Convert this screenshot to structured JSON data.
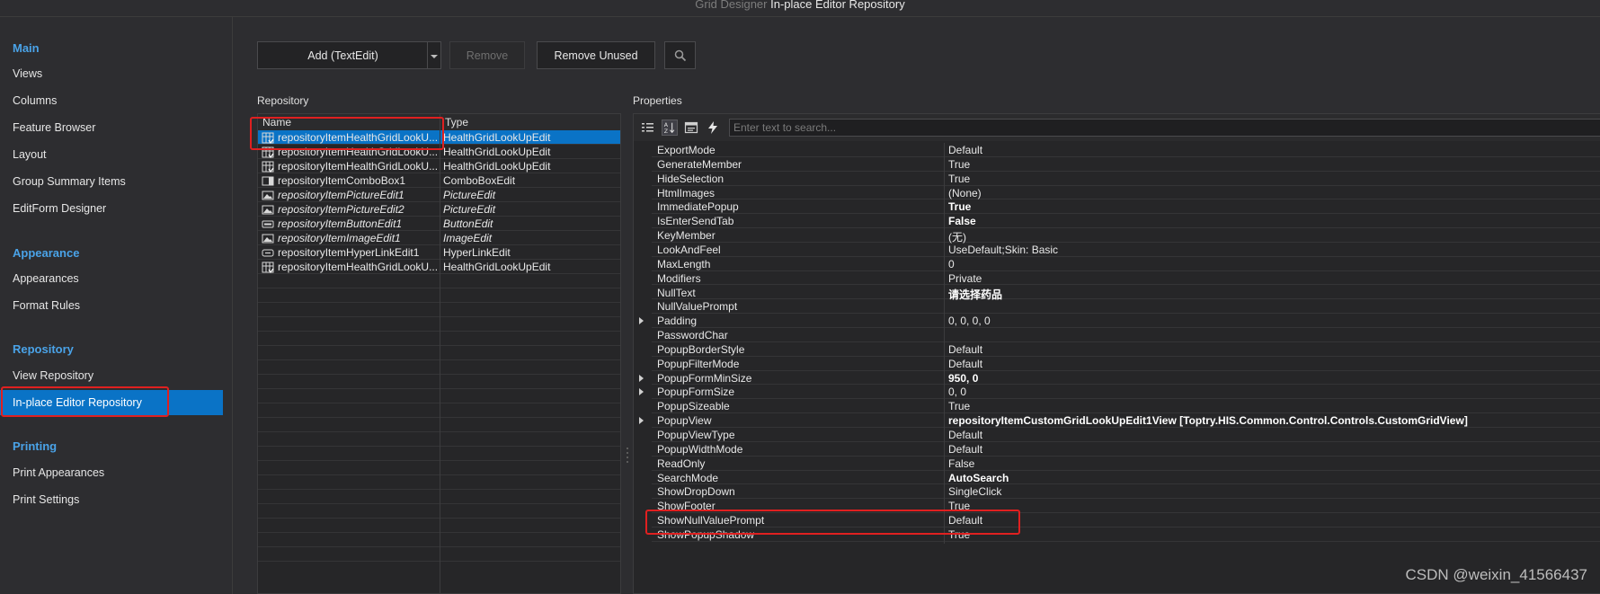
{
  "window": {
    "title_prefix": "Grid Designer",
    "title_main": "In-place Editor Repository"
  },
  "sidebar": {
    "groups": [
      {
        "label": "Main",
        "items": [
          "Views",
          "Columns",
          "Feature Browser",
          "Layout",
          "Group Summary Items",
          "EditForm Designer"
        ]
      },
      {
        "label": "Appearance",
        "items": [
          "Appearances",
          "Format Rules"
        ]
      },
      {
        "label": "Repository",
        "items": [
          "View Repository",
          "In-place Editor Repository"
        ]
      },
      {
        "label": "Printing",
        "items": [
          "Print Appearances",
          "Print Settings"
        ]
      }
    ],
    "selected": "In-place Editor Repository"
  },
  "toolbar": {
    "add_label": "Add (TextEdit)",
    "remove_label": "Remove",
    "remove_unused_label": "Remove Unused"
  },
  "repository": {
    "label": "Repository",
    "col_name": "Name",
    "col_type": "Type",
    "rows": [
      {
        "name": "repositoryItemHealthGridLookU...",
        "type": "HealthGridLookUpEdit",
        "icon": "grid-lookup-icon",
        "italic": false,
        "selected": true
      },
      {
        "name": "repositoryItemHealthGridLookU...",
        "type": "HealthGridLookUpEdit",
        "icon": "grid-lookup-icon",
        "italic": false,
        "selected": false
      },
      {
        "name": "repositoryItemHealthGridLookU...",
        "type": "HealthGridLookUpEdit",
        "icon": "grid-lookup-icon",
        "italic": false,
        "selected": false
      },
      {
        "name": "repositoryItemComboBox1",
        "type": "ComboBoxEdit",
        "icon": "combobox-icon",
        "italic": false,
        "selected": false
      },
      {
        "name": "repositoryItemPictureEdit1",
        "type": "PictureEdit",
        "icon": "picture-icon",
        "italic": true,
        "selected": false
      },
      {
        "name": "repositoryItemPictureEdit2",
        "type": "PictureEdit",
        "icon": "picture-icon",
        "italic": true,
        "selected": false
      },
      {
        "name": "repositoryItemButtonEdit1",
        "type": "ButtonEdit",
        "icon": "button-edit-icon",
        "italic": true,
        "selected": false
      },
      {
        "name": "repositoryItemImageEdit1",
        "type": "ImageEdit",
        "icon": "picture-icon",
        "italic": true,
        "selected": false
      },
      {
        "name": "repositoryItemHyperLinkEdit1",
        "type": "HyperLinkEdit",
        "icon": "hyperlink-icon",
        "italic": false,
        "selected": false
      },
      {
        "name": "repositoryItemHealthGridLookU...",
        "type": "HealthGridLookUpEdit",
        "icon": "grid-lookup-icon",
        "italic": false,
        "selected": false
      }
    ]
  },
  "properties": {
    "label": "Properties",
    "search_placeholder": "Enter text to search...",
    "rows": [
      {
        "name": "ExportMode",
        "value": "Default",
        "bold": false,
        "expandable": false
      },
      {
        "name": "GenerateMember",
        "value": "True",
        "bold": false,
        "expandable": false
      },
      {
        "name": "HideSelection",
        "value": "True",
        "bold": false,
        "expandable": false
      },
      {
        "name": "HtmlImages",
        "value": "(None)",
        "bold": false,
        "expandable": false
      },
      {
        "name": "ImmediatePopup",
        "value": "True",
        "bold": true,
        "expandable": false
      },
      {
        "name": "IsEnterSendTab",
        "value": "False",
        "bold": true,
        "expandable": false
      },
      {
        "name": "KeyMember",
        "value": "(无)",
        "bold": false,
        "expandable": false
      },
      {
        "name": "LookAndFeel",
        "value": "UseDefault;Skin: Basic",
        "bold": false,
        "expandable": false
      },
      {
        "name": "MaxLength",
        "value": "0",
        "bold": false,
        "expandable": false
      },
      {
        "name": "Modifiers",
        "value": "Private",
        "bold": false,
        "expandable": false
      },
      {
        "name": "NullText",
        "value": "请选择药品",
        "bold": true,
        "expandable": false
      },
      {
        "name": "NullValuePrompt",
        "value": "",
        "bold": false,
        "expandable": false
      },
      {
        "name": "Padding",
        "value": "0, 0, 0, 0",
        "bold": false,
        "expandable": true
      },
      {
        "name": "PasswordChar",
        "value": "",
        "bold": false,
        "expandable": false
      },
      {
        "name": "PopupBorderStyle",
        "value": "Default",
        "bold": false,
        "expandable": false
      },
      {
        "name": "PopupFilterMode",
        "value": "Default",
        "bold": false,
        "expandable": false
      },
      {
        "name": "PopupFormMinSize",
        "value": "950, 0",
        "bold": true,
        "expandable": true
      },
      {
        "name": "PopupFormSize",
        "value": "0, 0",
        "bold": false,
        "expandable": true
      },
      {
        "name": "PopupSizeable",
        "value": "True",
        "bold": false,
        "expandable": false
      },
      {
        "name": "PopupView",
        "value": "repositoryItemCustomGridLookUpEdit1View [Toptry.HIS.Common.Control.Controls.CustomGridView]",
        "bold": true,
        "expandable": true
      },
      {
        "name": "PopupViewType",
        "value": "Default",
        "bold": false,
        "expandable": false
      },
      {
        "name": "PopupWidthMode",
        "value": "Default",
        "bold": false,
        "expandable": false
      },
      {
        "name": "ReadOnly",
        "value": "False",
        "bold": false,
        "expandable": false
      },
      {
        "name": "SearchMode",
        "value": "AutoSearch",
        "bold": true,
        "expandable": false
      },
      {
        "name": "ShowDropDown",
        "value": "SingleClick",
        "bold": false,
        "expandable": false
      },
      {
        "name": "ShowFooter",
        "value": "True",
        "bold": false,
        "expandable": false
      },
      {
        "name": "ShowNullValuePrompt",
        "value": "Default",
        "bold": false,
        "expandable": false
      },
      {
        "name": "ShowPopupShadow",
        "value": "True",
        "bold": false,
        "expandable": false
      }
    ]
  },
  "watermark": "CSDN @weixin_41566437",
  "colors": {
    "accent": "#0a73c6",
    "group_label": "#4aa3e8",
    "highlight": "#e02020"
  }
}
